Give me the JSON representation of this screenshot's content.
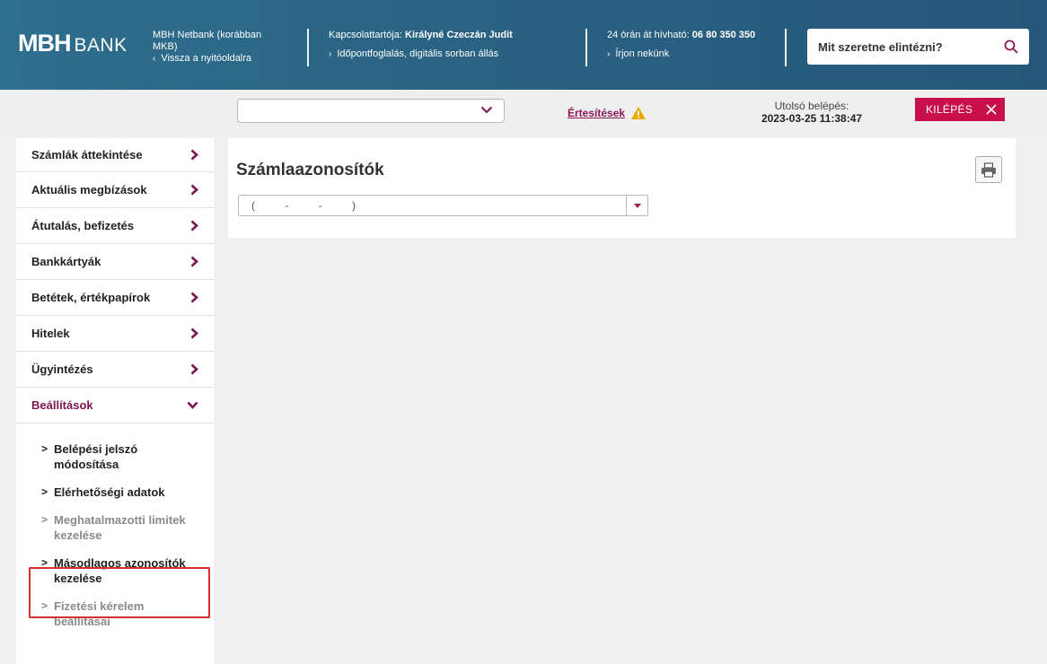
{
  "header": {
    "logo_mark": "MBH",
    "logo_text": "BANK",
    "netbank_line1": "MBH Netbank (korábban",
    "netbank_line2": "MKB)",
    "back_link": "Vissza a nyitóoldalra",
    "contact_label": "Kapcsolattartója:",
    "contact_name": "Királyné Czeczán Judit",
    "booking_link": "Időpontfoglalás, digitális sorban állás",
    "hotline_label": "24 órán át hívható:",
    "hotline_number": "06 80 350 350",
    "write_link": "Írjon nekünk",
    "search_placeholder": "Mit szeretne elintézni?"
  },
  "toolbar": {
    "select_value": "",
    "notifications_label": "Értesítések",
    "last_login_label": "Utolsó belépés:",
    "last_login_value": "2023-03-25 11:38:47",
    "logout_label": "KILÉPÉS"
  },
  "sidebar": {
    "items": [
      {
        "label": "Számlák áttekintése"
      },
      {
        "label": "Aktuális megbízások"
      },
      {
        "label": "Átutalás, befizetés"
      },
      {
        "label": "Bankkártyák"
      },
      {
        "label": "Betétek, értékpapírok"
      },
      {
        "label": "Hitelek"
      },
      {
        "label": "Ügyintézés"
      },
      {
        "label": "Beállítások"
      }
    ],
    "subitems": [
      {
        "line1": "Belépési jelszó",
        "line2": "módosítása"
      },
      {
        "line1": "Elérhetőségi adatok",
        "line2": ""
      },
      {
        "line1": "Meghatalmazotti limitek",
        "line2": "kezelése"
      },
      {
        "line1": "Másodlagos azonosítók",
        "line2": "kezelése"
      },
      {
        "line1": "Fizetési kérelem",
        "line2": "beállításai"
      }
    ]
  },
  "main": {
    "title": "Számlaazonosítók",
    "account_select_value": "(          -          -          )"
  },
  "colors": {
    "header_bg": "#2a6283",
    "accent": "#7b1450",
    "logout_bg": "#c80f4b",
    "highlight": "#d32f2f",
    "warning": "#e8a800"
  }
}
